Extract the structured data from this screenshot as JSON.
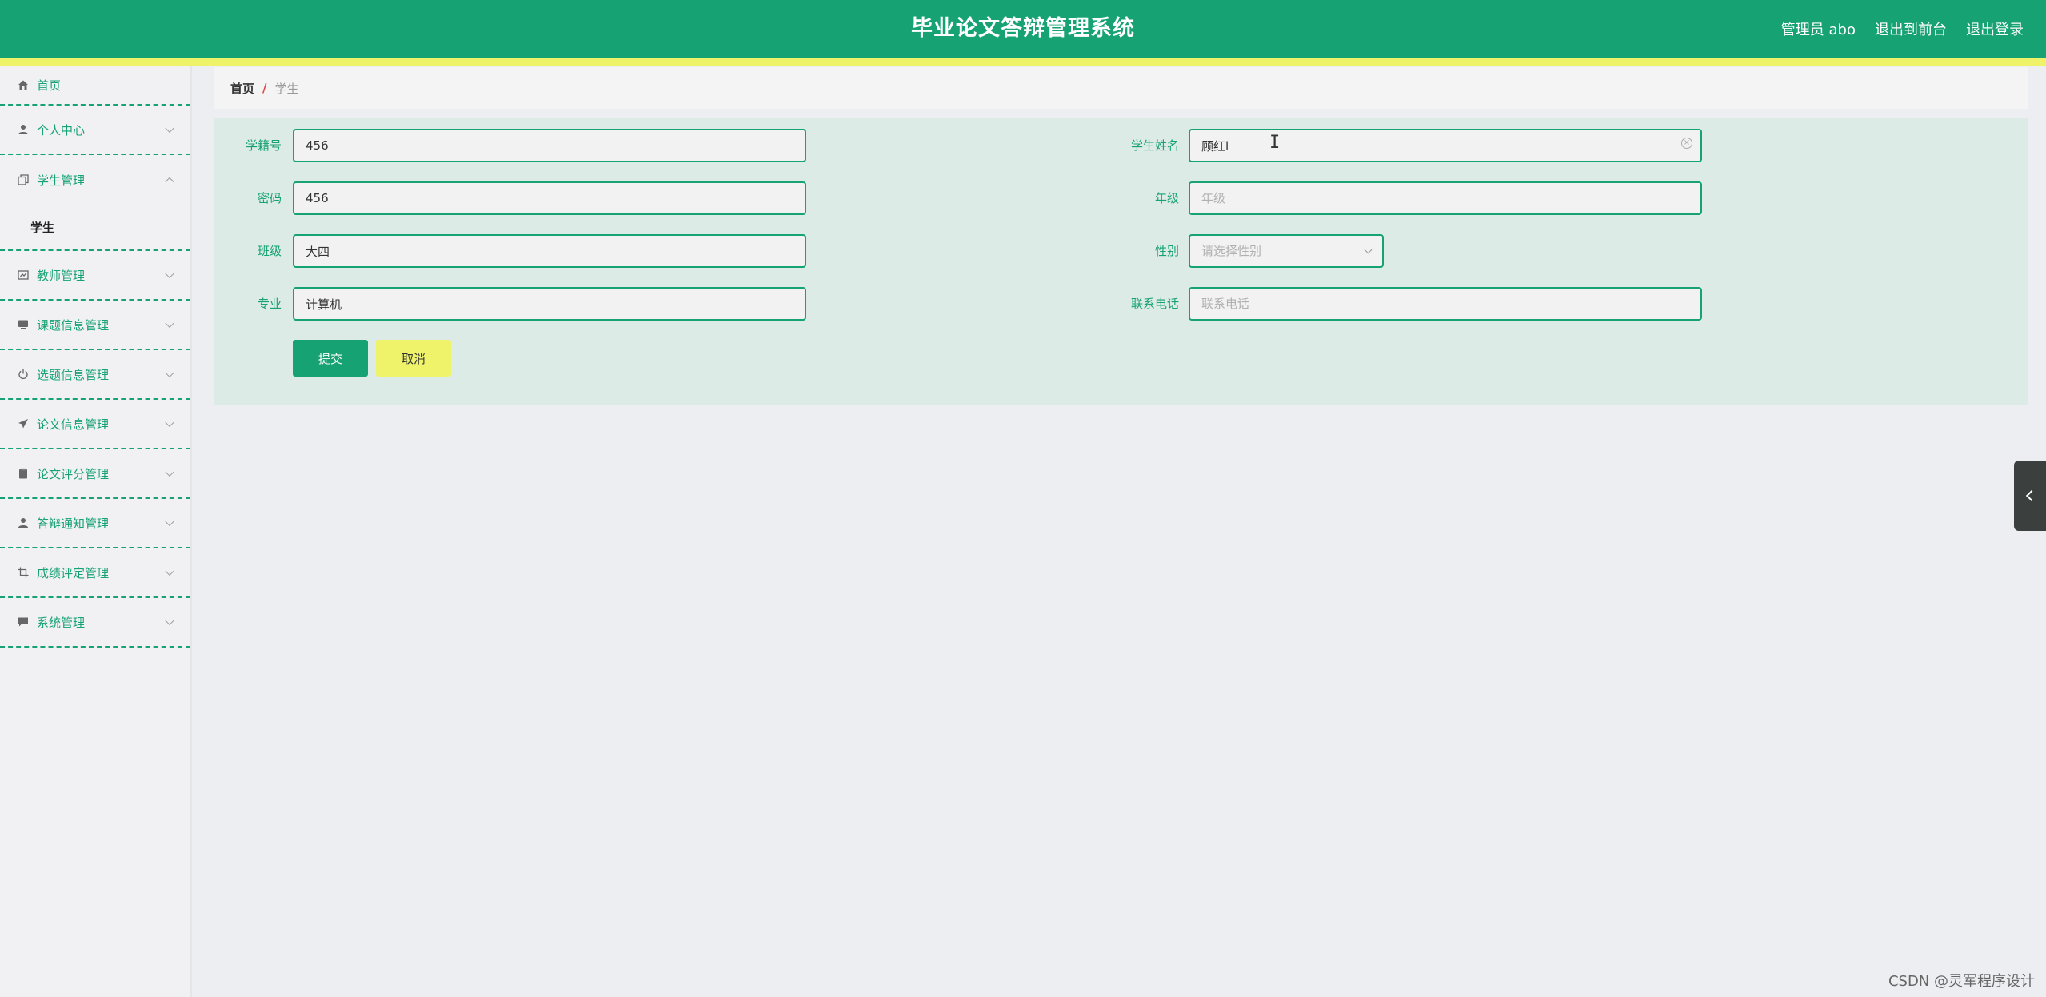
{
  "header": {
    "title": "毕业论文答辩管理系统",
    "admin_label": "管理员 abo",
    "to_front_label": "退出到前台",
    "logout_label": "退出登录",
    "brand_color": "#16a272",
    "accent_color": "#eef36a"
  },
  "sidebar": {
    "items": [
      {
        "label": "首页",
        "icon": "home-icon"
      },
      {
        "label": "个人中心",
        "icon": "user-icon"
      },
      {
        "label": "学生管理",
        "icon": "copy-icon",
        "expanded": true,
        "children": [
          {
            "label": "学生"
          }
        ]
      },
      {
        "label": "教师管理",
        "icon": "chart-card-icon"
      },
      {
        "label": "课题信息管理",
        "icon": "monitor-icon"
      },
      {
        "label": "选题信息管理",
        "icon": "power-icon"
      },
      {
        "label": "论文信息管理",
        "icon": "send-icon"
      },
      {
        "label": "论文评分管理",
        "icon": "clipboard-icon"
      },
      {
        "label": "答辩通知管理",
        "icon": "user-icon"
      },
      {
        "label": "成绩评定管理",
        "icon": "crop-icon"
      },
      {
        "label": "系统管理",
        "icon": "message-icon"
      }
    ]
  },
  "breadcrumb": {
    "home": "首页",
    "separator": "/",
    "current": "学生"
  },
  "form": {
    "student_id": {
      "label": "学籍号",
      "value": "456"
    },
    "student_name": {
      "label": "学生姓名",
      "value": "顾红l"
    },
    "password": {
      "label": "密码",
      "value": "456"
    },
    "grade": {
      "label": "年级",
      "value": "",
      "placeholder": "年级"
    },
    "class": {
      "label": "班级",
      "value": "大四"
    },
    "gender": {
      "label": "性别",
      "placeholder": "请选择性别"
    },
    "major": {
      "label": "专业",
      "value": "计算机"
    },
    "phone": {
      "label": "联系电话",
      "value": "",
      "placeholder": "联系电话"
    },
    "submit_label": "提交",
    "cancel_label": "取消"
  },
  "watermark": "CSDN @灵军程序设计"
}
